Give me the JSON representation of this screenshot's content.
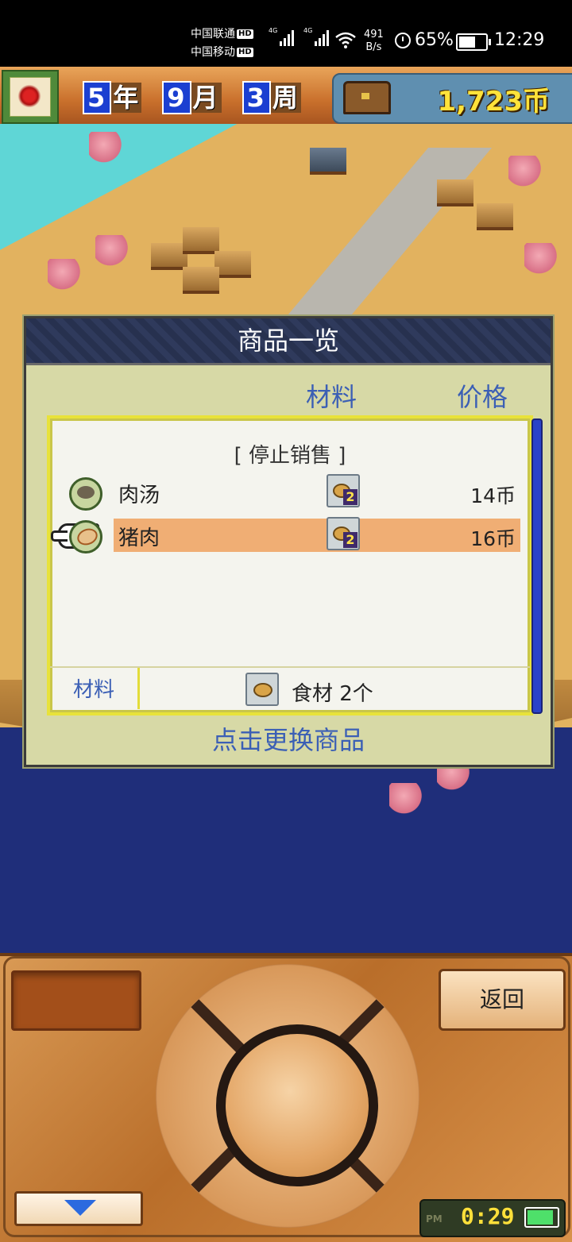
{
  "status_bar": {
    "carrier1": "中国联通",
    "carrier2": "中国移动",
    "hd_badge": "HD",
    "network_type": "4G",
    "net_speed_value": "491",
    "net_speed_unit": "B/s",
    "battery_percent": "65%",
    "time": "12:29"
  },
  "game_header": {
    "year_num": "5",
    "year_unit": "年",
    "month_num": "9",
    "month_unit": "月",
    "week_num": "3",
    "week_unit": "周",
    "money": "1,723币"
  },
  "dialog": {
    "title": "商品一览",
    "col_material": "材料",
    "col_price": "价格",
    "stop_sale": "[ 停止销售 ]",
    "items": [
      {
        "name": "肉汤",
        "material_qty": "2",
        "price": "14币",
        "selected": false
      },
      {
        "name": "猪肉",
        "material_qty": "2",
        "price": "16币",
        "selected": true
      }
    ],
    "footer_label": "材料",
    "footer_value": "食材 2个",
    "hint": "点击更换商品"
  },
  "controller": {
    "back_label": "返回",
    "ampm": "PM",
    "game_clock": "0:29"
  },
  "colors": {
    "dialog_bg": "#d7d9a6",
    "header_text_blue": "#3b5fb5",
    "selected_row": "#f0ae74",
    "money_yellow": "#ffe23a"
  }
}
